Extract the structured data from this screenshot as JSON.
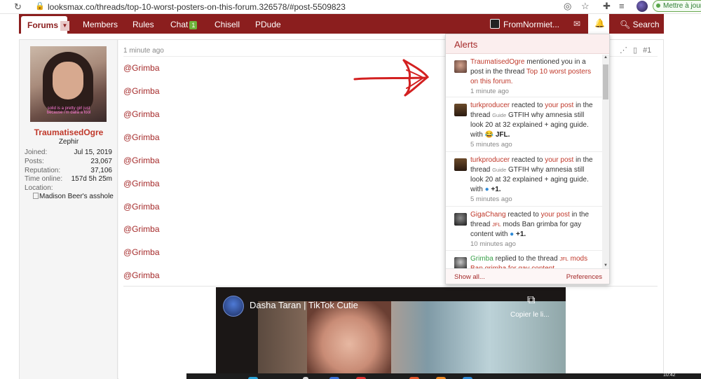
{
  "browser": {
    "url": "looksmax.co/threads/top-10-worst-posters-on-this-forum.326578/#post-5509823",
    "reload_icon": "reload-icon",
    "update_button": "Mettre à jour"
  },
  "nav": {
    "forums": "Forums",
    "members": "Members",
    "rules": "Rules",
    "chat": "Chat",
    "chat_badge": "1",
    "chisell": "Chisell",
    "pdude": "PDude",
    "username": "FromNormiet...",
    "search": "Search",
    "accent_color": "#8b1e1e"
  },
  "post": {
    "author": "TraumatisedOgre",
    "user_title": "Zephir",
    "stats": [
      {
        "label": "Joined:",
        "value": "Jul 15, 2019"
      },
      {
        "label": "Posts:",
        "value": "23,067"
      },
      {
        "label": "Reputation:",
        "value": "37,106"
      },
      {
        "label": "Time online:",
        "value": "157d 5h 25m"
      },
      {
        "label": "Location:",
        "value": ""
      }
    ],
    "location_image_alt": "Madison Beer's asshole",
    "avatar_caption": "solid is a pretty girl just because i'm dalla a fool",
    "time": "1 minute ago",
    "number": "#1",
    "mentions": [
      "@Grimba",
      "@Grimba",
      "@Grimba",
      "@Grimba",
      "@Grimba",
      "@Grimba",
      "@Grimba",
      "@Grimba",
      "@Grimba",
      "@Grimba"
    ]
  },
  "video": {
    "title": "Dasha Taran | TikTok Cutie",
    "copy_label": "Copier le li..."
  },
  "alerts": {
    "title": "Alerts",
    "show_all": "Show all...",
    "preferences": "Preferences",
    "items": [
      {
        "user": "TraumatisedOgre",
        "action": "mentioned you in a post in the thread",
        "thread": "Top 10 worst posters on this forum.",
        "time": "1 minute ago"
      },
      {
        "user": "turkproducer",
        "action_pre": "reacted to",
        "your_post": "your post",
        "action_post": "in the thread",
        "prefix": "Guide",
        "thread": "GTFIH why amnesia still look 20 at 32 explained + aging guide.",
        "with": "with",
        "reaction": "JFL.",
        "time": "5 minutes ago"
      },
      {
        "user": "turkproducer",
        "action_pre": "reacted to",
        "your_post": "your post",
        "action_post": "in the thread",
        "prefix": "Guide",
        "thread": "GTFIH why amnesia still look 20 at 32 explained + aging guide.",
        "with": "with",
        "reaction": "+1.",
        "time": "5 minutes ago"
      },
      {
        "user": "GigaChang",
        "action_pre": "reacted to",
        "your_post": "your post",
        "action_post": "in the thread",
        "prefix": "JFL",
        "thread": "mods Ban grimba for gay content",
        "with": "with",
        "reaction": "+1.",
        "time": "10 minutes ago"
      },
      {
        "user": "Grimba",
        "action": "replied to the thread",
        "prefix": "JFL",
        "thread": "mods Ban grimba for gay content."
      }
    ]
  },
  "taskbar": {
    "clock": "10:42"
  }
}
